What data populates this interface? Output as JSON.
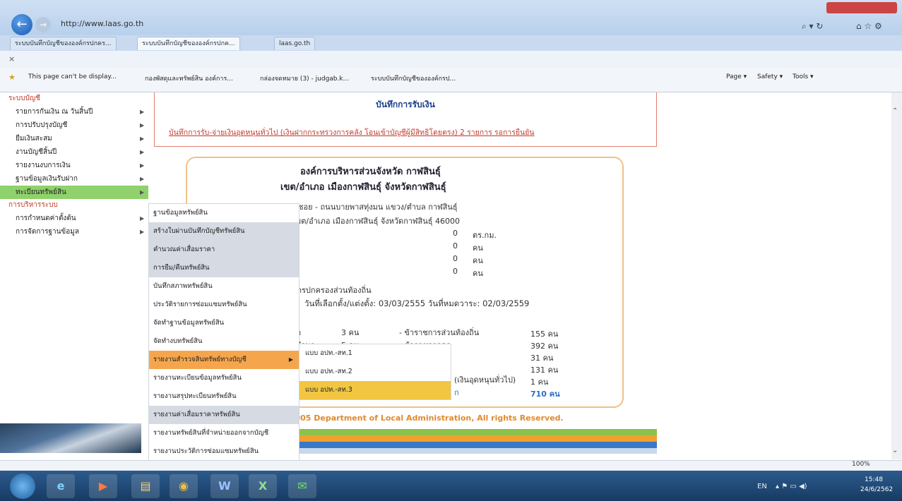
{
  "browser": {
    "url": "http://www.laas.go.th",
    "tabs": [
      {
        "label": "ระบบบันทึกบัญชีขององค์กรปกคร..."
      },
      {
        "label": "ระบบบันทึกบัญชีขององค์กรปกค..."
      },
      {
        "label": "laas.go.th"
      }
    ],
    "favorites": [
      {
        "label": "This page can't be display..."
      },
      {
        "label": "กองพัสดุและทรัพย์สิน องค์การ..."
      },
      {
        "label": "กล่องจดหมาย (3) - judgab.k..."
      },
      {
        "label": "ระบบบันทึกบัญชีขององค์กรป..."
      }
    ],
    "commands": {
      "page": "Page ▾",
      "safety": "Safety ▾",
      "tools": "Tools ▾"
    },
    "zoom": "100%"
  },
  "sidebar": {
    "section1": "ระบบบัญชี",
    "items1": [
      {
        "label": "รายการกันเงิน ณ วันสิ้นปี"
      },
      {
        "label": "การปรับปรุงบัญชี"
      },
      {
        "label": "ยืมเงินสะสม"
      },
      {
        "label": "งานบัญชีสิ้นปี"
      },
      {
        "label": "รายงานงบการเงิน"
      },
      {
        "label": "ฐานข้อมูลเงินรับฝาก"
      },
      {
        "label": "ทะเบียนทรัพย์สิน"
      }
    ],
    "section2": "การบริหารระบบ",
    "items2": [
      {
        "label": "การกำหนดค่าตั้งต้น"
      },
      {
        "label": "การจัดการฐานข้อมูล"
      }
    ]
  },
  "submenu": [
    {
      "label": "ฐานข้อมูลทรัพย์สิน"
    },
    {
      "label": "สร้างใบผ่านบันทึกบัญชีทรัพย์สิน"
    },
    {
      "label": "คำนวณค่าเสื่อมราคา"
    },
    {
      "label": "การยืม/คืนทรัพย์สิน"
    },
    {
      "label": "บันทึกสภาพทรัพย์สิน"
    },
    {
      "label": "ประวัติรายการซ่อมแซมทรัพย์สิน"
    },
    {
      "label": "จัดทำฐานข้อมูลทรัพย์สิน"
    },
    {
      "label": "จัดทำงบทรัพย์สิน"
    },
    {
      "label": "รายงานสำรวจสินทรัพย์ทางบัญชี"
    },
    {
      "label": "รายงานทะเบียนข้อมูลทรัพย์สิน"
    },
    {
      "label": "รายงานสรุปทะเบียนทรัพย์สิน"
    },
    {
      "label": "รายงานค่าเสื่อมราคาทรัพย์สิน"
    },
    {
      "label": "รายงานทรัพย์สินที่จำหน่ายออกจากบัญชี"
    },
    {
      "label": "รายงานประวัติการซ่อมแซมทรัพย์สิน"
    }
  ],
  "submenu2": [
    {
      "label": "แบบ อปท.-สท.1"
    },
    {
      "label": "แบบ อปท.-สท.2"
    },
    {
      "label": "แบบ อปท.-สท.3"
    }
  ],
  "top": {
    "title": "บันทึกการรับเงิน",
    "link": "บันทึกการรับ-จ่ายเงินอุดหนุนทั่วไป (เงินฝากกระทรวงการคลัง โอนเข้าบัญชีผู้มีสิทธิโดยตรง) 2 รายการ รอการยืนยัน"
  },
  "info": {
    "org": "องค์การบริหารส่วนจังหวัด กาฬสินธุ์",
    "district": "เขต/อำเภอ เมืองกาฬสินธุ์ จังหวัดกาฬสินธุ์",
    "addr1": "?/47  ซอย -  ถนนบายพาสทุ่งมน  แขวง/ตำบล กาฬสินธุ์",
    "addr2": "เขต/อำเภอ เมืองกาฬสินธุ์  จังหวัดกาฬสินธุ์  46000",
    "stats": [
      {
        "prefix": "",
        "value": "0",
        "unit": "ตร.กม."
      },
      {
        "prefix": "ด",
        "value": "0",
        "unit": "คน"
      },
      {
        "prefix": "",
        "value": "0",
        "unit": "คน"
      },
      {
        "prefix": "",
        "value": "0",
        "unit": "คน"
      }
    ],
    "admin_label": "ค์กรปกครองส่วนท้องถิ่น",
    "term": "วันที่เลือกตั้ง/แต่งตั้ง: 03/03/2555    วันที่หมดวาระ: 02/03/2559",
    "staff_left": [
      {
        "label": "ยก",
        "value": "3 คน"
      },
      {
        "label": "ปรึกษา",
        "value": "5 คน"
      }
    ],
    "staff_right": [
      {
        "label": "- ข้าราชการส่วนท้องถิ่น",
        "value": "155 คน"
      },
      {
        "label": "- ข้าราชการครู",
        "value": "392 คน"
      },
      {
        "label": "",
        "value": "31 คน"
      },
      {
        "label": "",
        "value": "131 คน"
      },
      {
        "label": "(เงินอุดหนุนทั่วไป)",
        "value": "1 คน"
      },
      {
        "label": "ก",
        "value": "710 คน"
      }
    ]
  },
  "footer": "© 2005 Department of Local Administration, All rights Reserved.",
  "taskbar": {
    "lang": "EN",
    "time": "15:48",
    "date": "24/6/2562"
  }
}
